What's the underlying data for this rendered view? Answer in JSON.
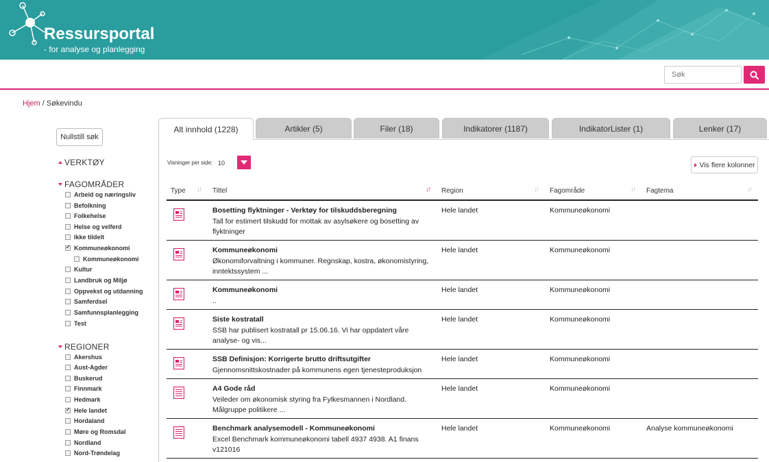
{
  "brand": {
    "title": "Ressursportal",
    "subtitle": "- for analyse og planlegging",
    "color": "#2a9d9e",
    "accent": "#e02a74"
  },
  "search": {
    "placeholder": "Søk",
    "button_icon": "search-icon"
  },
  "breadcrumb": {
    "home": "Hjem",
    "separator": "/",
    "current": "Søkevindu"
  },
  "sidebar": {
    "reset_label": "Nullstill søk",
    "verktoy_label": "VERKTØY",
    "fagomrader_label": "FAGOMRÅDER",
    "fagomrader": [
      {
        "label": "Arbeid og næringsliv",
        "checked": false
      },
      {
        "label": "Befolkning",
        "checked": false
      },
      {
        "label": "Folkehelse",
        "checked": false
      },
      {
        "label": "Helse og velferd",
        "checked": false
      },
      {
        "label": "Ikke tildelt",
        "checked": false
      },
      {
        "label": "Kommuneøkonomi",
        "checked": true
      },
      {
        "label": "Kommuneøkonomi",
        "checked": false
      },
      {
        "label": "Kultur",
        "checked": false
      },
      {
        "label": "Landbruk og Miljø",
        "checked": false
      },
      {
        "label": "Oppvekst og utdanning",
        "checked": false
      },
      {
        "label": "Samferdsel",
        "checked": false
      },
      {
        "label": "Samfunnsplanlegging",
        "checked": false
      },
      {
        "label": "Test",
        "checked": false
      }
    ],
    "regioner_label": "REGIONER",
    "regioner": [
      {
        "label": "Akershus",
        "checked": false
      },
      {
        "label": "Aust-Agder",
        "checked": false
      },
      {
        "label": "Buskerud",
        "checked": false
      },
      {
        "label": "Finnmark",
        "checked": false
      },
      {
        "label": "Hedmark",
        "checked": false
      },
      {
        "label": "Hele landet",
        "checked": true
      },
      {
        "label": "Hordaland",
        "checked": false
      },
      {
        "label": "Møre og Romsdal",
        "checked": false
      },
      {
        "label": "Nordland",
        "checked": false
      },
      {
        "label": "Nord-Trøndelag",
        "checked": false
      }
    ]
  },
  "tabs": [
    {
      "label": "Alt innhold (1228)",
      "active": true
    },
    {
      "label": "Artikler (5)",
      "active": false
    },
    {
      "label": "Filer (18)",
      "active": false
    },
    {
      "label": "Indikatorer (1187)",
      "active": false
    },
    {
      "label": "IndikatorLister (1)",
      "active": false
    },
    {
      "label": "Lenker (17)",
      "active": false
    }
  ],
  "controls": {
    "per_page_label": "Visninger per side:",
    "per_page_value": "10",
    "more_columns_label": "Vis flere kolonner"
  },
  "table": {
    "headers": {
      "type": "Type",
      "title": "Tittel",
      "region": "Region",
      "fagomrade": "Fagområde",
      "fagtema": "Fagtema"
    },
    "rows": [
      {
        "icon": "article-icon",
        "title": "Bosetting flyktninger - Verktøy for tilskuddsberegning",
        "desc": "Tall for estimert tilskudd for mottak av asylsøkere og bosetting av flyktninger",
        "region": "Hele landet",
        "fagomrade": "Kommuneøkonomi",
        "fagtema": ""
      },
      {
        "icon": "article-icon",
        "title": "Kommuneøkonomi",
        "desc": "Økonomiforvaltning i kommuner. Regnskap, kostra, økonomistyring, inntektssystem ...",
        "region": "Hele landet",
        "fagomrade": "Kommuneøkonomi",
        "fagtema": ""
      },
      {
        "icon": "article-icon",
        "title": "Kommuneøkonomi",
        "desc": "..",
        "region": "Hele landet",
        "fagomrade": "Kommuneøkonomi",
        "fagtema": ""
      },
      {
        "icon": "article-icon",
        "title": "Siste kostratall",
        "desc": "SSB har publisert kostratall pr 15.06.16. Vi har oppdatert våre analyse- og vis...",
        "region": "Hele landet",
        "fagomrade": "Kommuneøkonomi",
        "fagtema": ""
      },
      {
        "icon": "article-icon",
        "title": "SSB Definisjon: Korrigerte brutto driftsutgifter",
        "desc": "Gjennomsnittskostnader på kommunens egen tjenesteproduksjon",
        "region": "Hele landet",
        "fagomrade": "Kommuneøkonomi",
        "fagtema": ""
      },
      {
        "icon": "file-icon",
        "title": "A4 Gode råd",
        "desc": "Veileder om økonomisk styring fra Fylkesmannen i Nordland. Målgruppe politikere ...",
        "region": "Hele landet",
        "fagomrade": "Kommuneøkonomi",
        "fagtema": ""
      },
      {
        "icon": "file-icon",
        "title": "Benchmark analysemodell - Kommuneøkonomi",
        "desc": "Excel Benchmark kommuneøkonomi tabell 4937 4938. A1 finans v121016",
        "region": "Hele landet",
        "fagomrade": "Kommuneøkonomi",
        "fagtema": "Analyse kommuneøkonomi"
      }
    ]
  }
}
